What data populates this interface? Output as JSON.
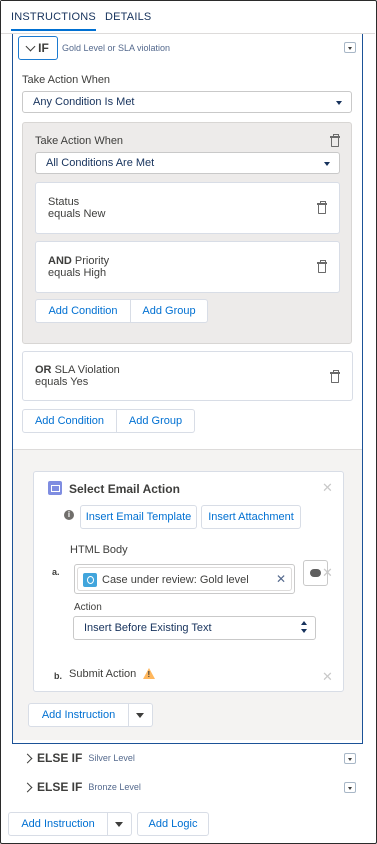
{
  "tabs": [
    {
      "label": "INSTRUCTIONS",
      "active": true
    },
    {
      "label": "DETAILS",
      "active": false
    }
  ],
  "if_block": {
    "keyword": "IF",
    "title": "Gold Level or SLA violation",
    "take_action_label": "Take Action When",
    "take_action_value": "Any Condition Is Met",
    "group": {
      "take_action_label": "Take Action When",
      "take_action_value": "All Conditions Are Met",
      "conditions": [
        {
          "prefix": "",
          "field": "Status",
          "criteria": "equals New"
        },
        {
          "prefix": "AND",
          "field": "Priority",
          "criteria": "equals High"
        }
      ],
      "add_condition_label": "Add Condition",
      "add_group_label": "Add Group"
    },
    "or_condition": {
      "prefix": "OR",
      "field": "SLA Violation",
      "criteria": "equals Yes"
    },
    "add_condition_label": "Add Condition",
    "add_group_label": "Add Group"
  },
  "email_action": {
    "title": "Select Email Action",
    "insert_template_label": "Insert Email Template",
    "insert_attachment_label": "Insert Attachment",
    "html_body_label": "HTML Body",
    "step_a": "a.",
    "template_pill": "Case under review: Gold level",
    "action_label": "Action",
    "action_value": "Insert Before Existing Text",
    "step_b": "b.",
    "submit_action_label": "Submit Action"
  },
  "inner_add_instruction_label": "Add Instruction",
  "else_ifs": [
    {
      "keyword": "ELSE IF",
      "title": "Silver Level"
    },
    {
      "keyword": "ELSE IF",
      "title": "Bronze Level"
    }
  ],
  "footer": {
    "add_instruction_label": "Add Instruction",
    "add_logic_label": "Add Logic"
  },
  "colors": {
    "accent_blue": "#0070d2",
    "panel_border": "#1b5297",
    "group_bg": "#edebea",
    "email_icon": "#7f8de1",
    "template_icon": "#41a5dc",
    "warning": "#ffb75d"
  },
  "icons": [
    "chevron-down-icon",
    "chevron-right-icon",
    "dropdown-caret-icon",
    "trash-icon",
    "email-icon",
    "info-icon",
    "close-icon",
    "template-icon",
    "chat-icon",
    "warning-icon"
  ]
}
